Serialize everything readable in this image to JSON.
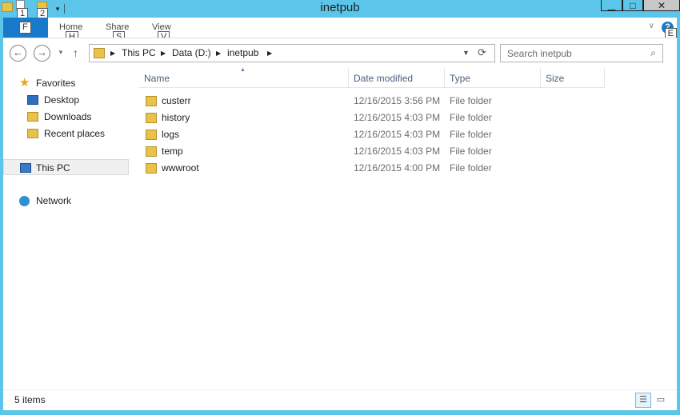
{
  "window": {
    "title": "inetpub",
    "minimize": "▁",
    "maximize": "□",
    "close": "✕"
  },
  "qat": {
    "keytips": [
      "1",
      "2"
    ],
    "dropdown": "▾"
  },
  "ribbon": {
    "file_tab": "F",
    "tabs": [
      {
        "label": "Home",
        "keytip": "H"
      },
      {
        "label": "Share",
        "keytip": "S"
      },
      {
        "label": "View",
        "keytip": "V"
      }
    ],
    "help_keytip": "E",
    "help": "?"
  },
  "address": {
    "crumbs": [
      "This PC",
      "Data (D:)",
      "inetpub"
    ],
    "search_placeholder": "Search inetpub"
  },
  "nav": {
    "favorites": "Favorites",
    "desktop": "Desktop",
    "downloads": "Downloads",
    "recent": "Recent places",
    "this_pc": "This PC",
    "network": "Network"
  },
  "columns": {
    "name": "Name",
    "date": "Date modified",
    "type": "Type",
    "size": "Size"
  },
  "files": [
    {
      "name": "custerr",
      "date": "12/16/2015 3:56 PM",
      "type": "File folder"
    },
    {
      "name": "history",
      "date": "12/16/2015 4:03 PM",
      "type": "File folder"
    },
    {
      "name": "logs",
      "date": "12/16/2015 4:03 PM",
      "type": "File folder"
    },
    {
      "name": "temp",
      "date": "12/16/2015 4:03 PM",
      "type": "File folder"
    },
    {
      "name": "wwwroot",
      "date": "12/16/2015 4:00 PM",
      "type": "File folder"
    }
  ],
  "status": {
    "item_count": "5 items"
  },
  "colors": {
    "accent": "#1979ca",
    "frame": "#5bc6ea",
    "folder": "#e8c34a"
  }
}
